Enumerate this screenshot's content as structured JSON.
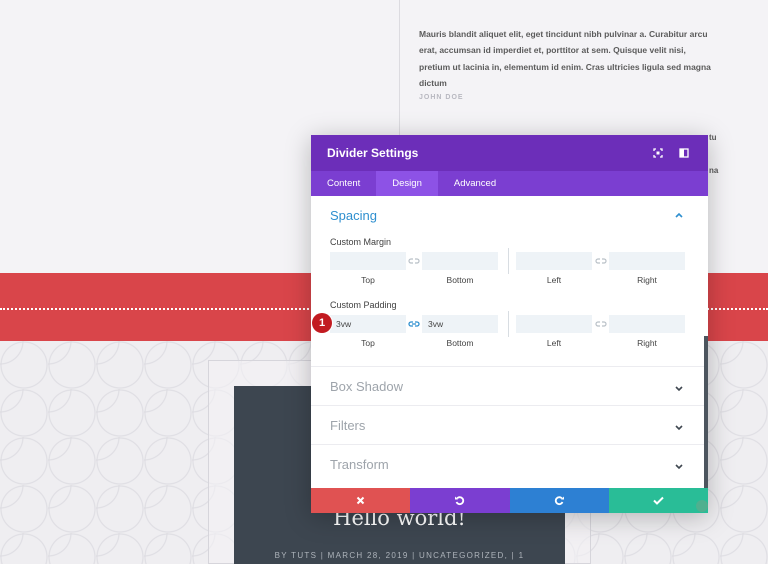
{
  "background": {
    "quote": "Mauris blandit aliquet elit, eget tincidunt nibh pulvinar a. Curabitur arcu erat, accumsan id imperdiet et, porttitor at sem. Quisque velit nisi, pretium ut lacinia in, elementum id enim. Cras ultricies ligula sed magna dictum",
    "author": "JOHN DOE",
    "peek_1": "tu",
    "peek_2": "na",
    "post_title": "Hello world!",
    "post_meta": "BY TUTS | MARCH 28, 2019 | UNCATEGORIZED, | 1"
  },
  "modal": {
    "title": "Divider Settings",
    "header_icons": [
      "expand-icon",
      "sidebar-toggle-icon"
    ],
    "tabs": [
      {
        "label": "Content",
        "active": false
      },
      {
        "label": "Design",
        "active": true
      },
      {
        "label": "Advanced",
        "active": false
      }
    ],
    "spacing": {
      "title": "Spacing",
      "margin": {
        "label": "Custom Margin",
        "top": "",
        "bottom": "",
        "left": "",
        "right": "",
        "sub_top": "Top",
        "sub_bottom": "Bottom",
        "sub_left": "Left",
        "sub_right": "Right"
      },
      "padding": {
        "label": "Custom Padding",
        "top": "3vw",
        "bottom": "3vw",
        "left": "",
        "right": "",
        "sub_top": "Top",
        "sub_bottom": "Bottom",
        "sub_left": "Left",
        "sub_right": "Right"
      }
    },
    "collapsed_sections": [
      "Box Shadow",
      "Filters",
      "Transform"
    ],
    "footer_buttons": [
      {
        "name": "cancel",
        "icon": "close-icon",
        "color": "#e05252"
      },
      {
        "name": "undo",
        "icon": "undo-icon",
        "color": "#7b3ed1"
      },
      {
        "name": "redo",
        "icon": "redo-icon",
        "color": "#2d80d3"
      },
      {
        "name": "save",
        "icon": "check-icon",
        "color": "#29bd97"
      }
    ]
  },
  "annotation": {
    "step": "1"
  },
  "colors": {
    "header": "#6c2eb9",
    "tabs": "#7b3ed1",
    "accent_blue": "#2e8fcf",
    "red_band": "#d9454a"
  }
}
